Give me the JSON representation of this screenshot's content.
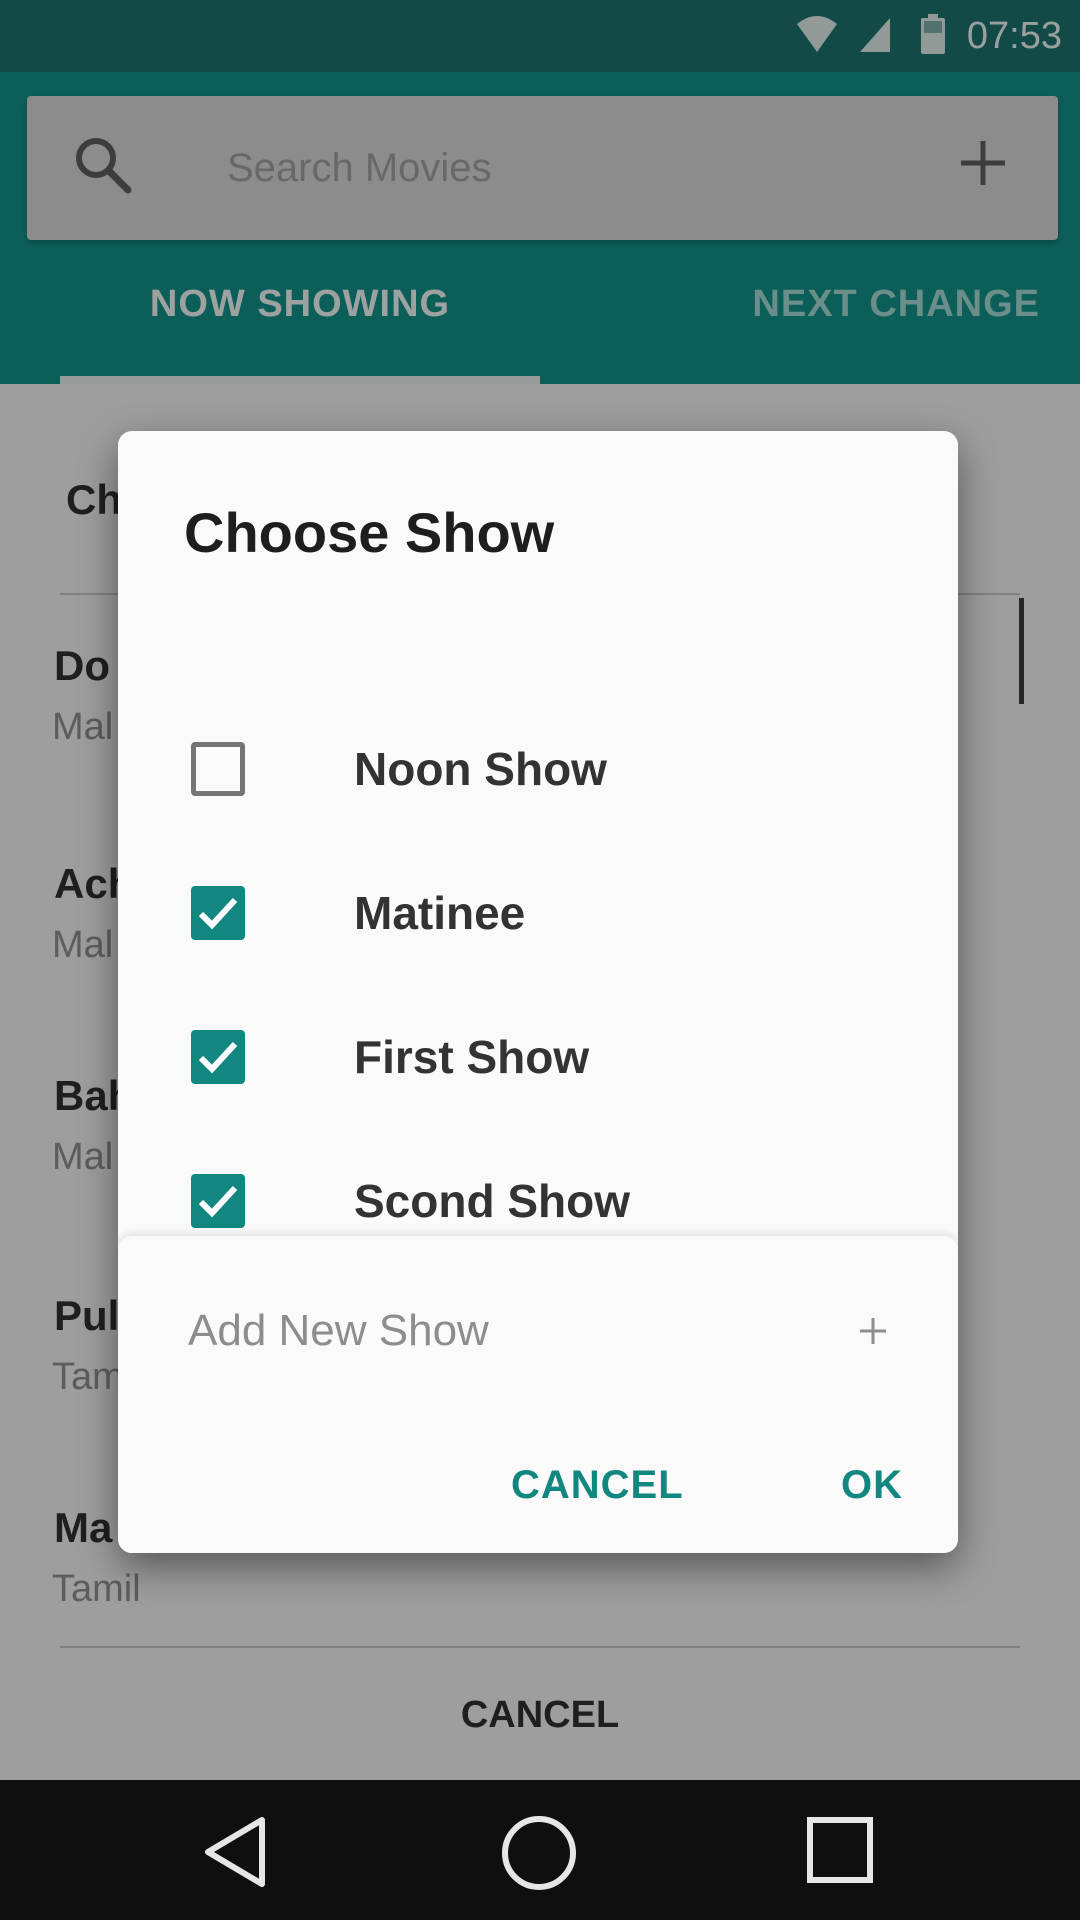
{
  "status_bar": {
    "time": "07:53",
    "icons": [
      "wifi-icon",
      "cell-signal-icon",
      "battery-icon"
    ]
  },
  "search": {
    "placeholder": "Search Movies",
    "icon": "search-icon",
    "action_icon": "plus-icon"
  },
  "tabs": [
    {
      "label": "NOW SHOWING",
      "active": true
    },
    {
      "label": "NEXT CHANGE",
      "active": false
    }
  ],
  "background_list": {
    "header": "Ch",
    "items": [
      {
        "title": "Do",
        "subtitle": "Mal"
      },
      {
        "title": "Ach",
        "subtitle": "Mal"
      },
      {
        "title": "Bah",
        "subtitle": "Mal"
      },
      {
        "title": "Pul",
        "subtitle": "Tam"
      },
      {
        "title": "Ma",
        "subtitle": "Tamil"
      }
    ],
    "cancel_label": "CANCEL"
  },
  "dialog": {
    "title": "Choose Show",
    "options": [
      {
        "label": "Noon Show",
        "checked": false
      },
      {
        "label": "Matinee",
        "checked": true
      },
      {
        "label": "First Show",
        "checked": true
      },
      {
        "label": "Scond Show",
        "checked": true
      }
    ],
    "add_new_label": "Add New Show",
    "cancel_label": "CANCEL",
    "ok_label": "OK"
  },
  "nav_bar": {
    "icons": [
      "back-icon",
      "home-icon",
      "recents-icon"
    ]
  },
  "colors": {
    "primary": "#138c84",
    "primary_dark": "#1a6e69",
    "accent": "#118780"
  }
}
